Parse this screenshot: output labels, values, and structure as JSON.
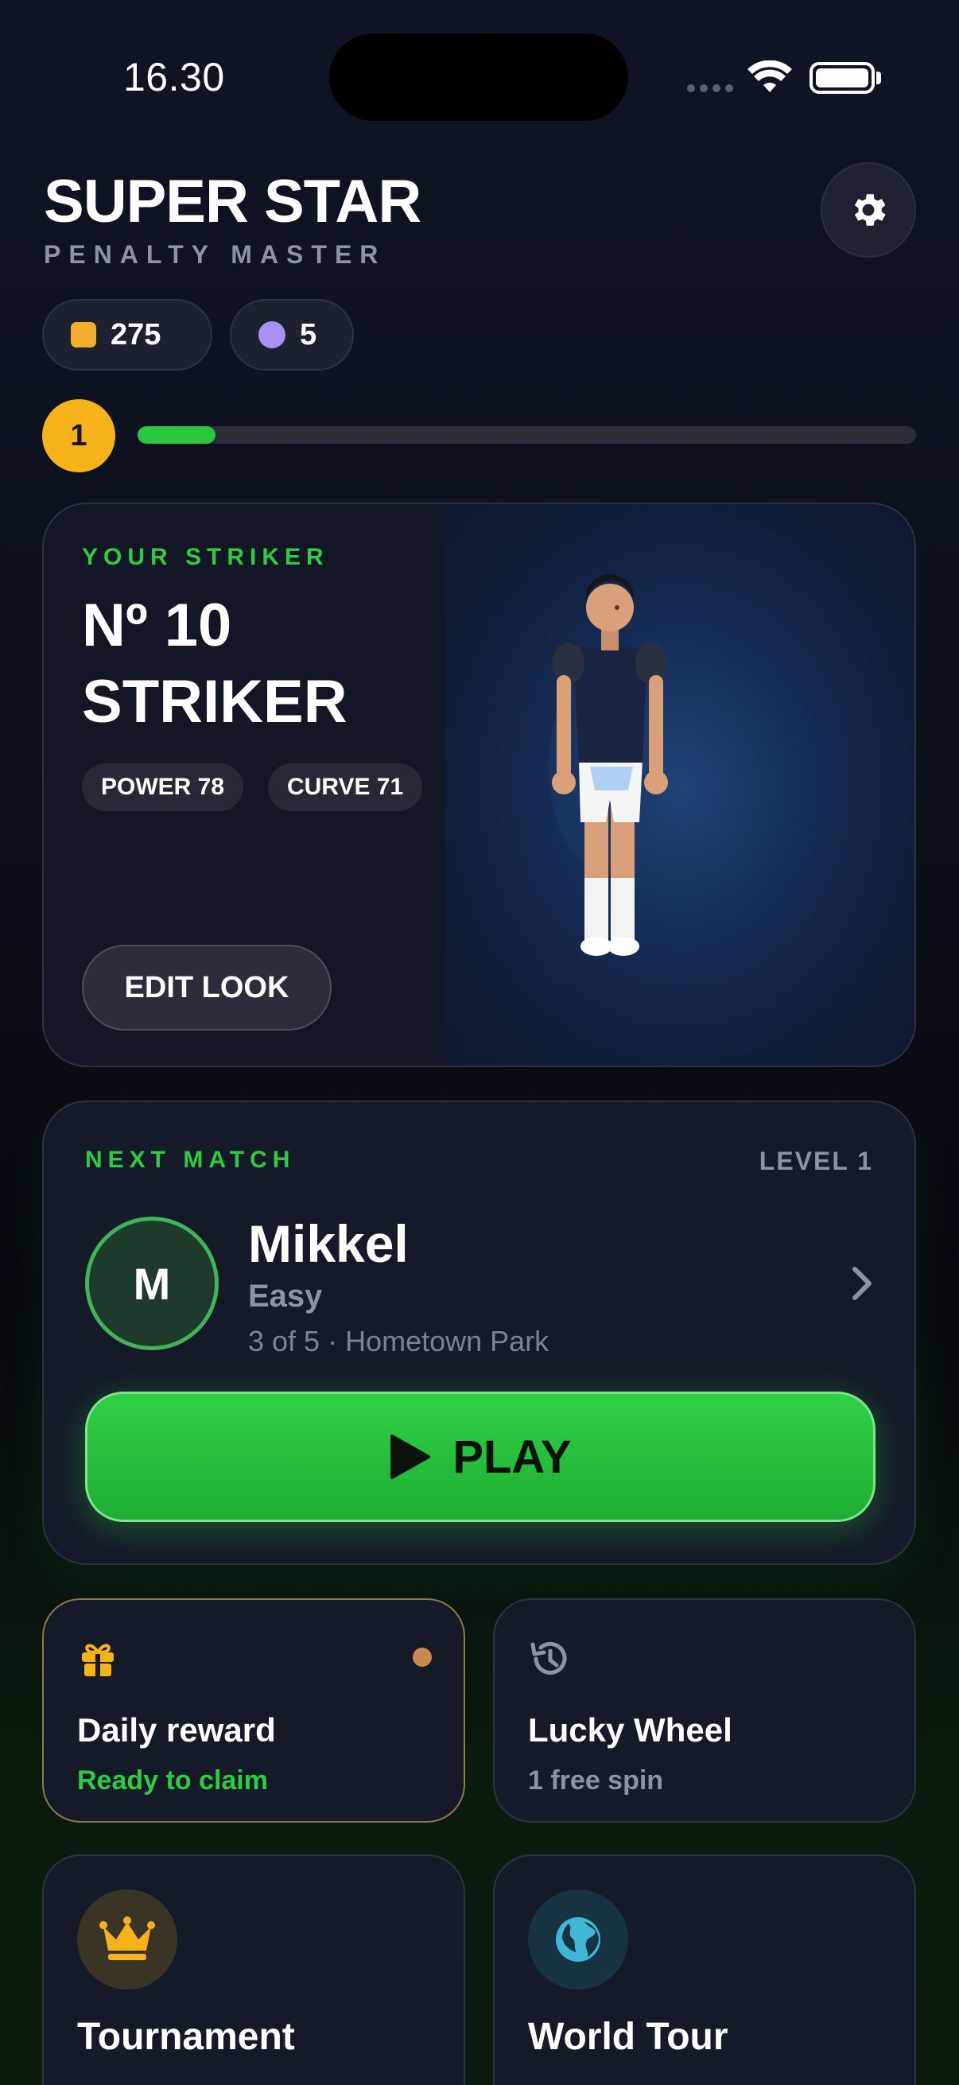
{
  "status_bar": {
    "time": "16.30"
  },
  "header": {
    "title": "SUPER STAR",
    "subtitle": "PENALTY MASTER"
  },
  "currency": {
    "coins": "275",
    "gems": "5"
  },
  "level": {
    "number": "1",
    "xp_progress": 0.1
  },
  "striker": {
    "label": "YOUR STRIKER",
    "name_line1": "Nº 10",
    "name_line2": "STRIKER",
    "power": "POWER 78",
    "curve": "CURVE 71",
    "edit_label": "EDIT LOOK"
  },
  "next_match": {
    "label": "NEXT MATCH",
    "level": "LEVEL 1",
    "avatar_initial": "M",
    "opponent": "Mikkel",
    "difficulty": "Easy",
    "progress": "3 of 5 · Hometown Park",
    "play_label": "PLAY"
  },
  "tiles": {
    "daily": {
      "title": "Daily reward",
      "subtitle": "Ready to claim",
      "icon": "gift-icon"
    },
    "lucky": {
      "title": "Lucky Wheel",
      "subtitle": "1 free spin",
      "icon": "history-icon"
    },
    "tournament": {
      "title": "Tournament",
      "icon": "crown-icon"
    },
    "world": {
      "title": "World Tour",
      "icon": "globe-icon"
    }
  },
  "colors": {
    "accent_green": "#2ecc40",
    "gold": "#f5b21a",
    "gem": "#a691f5"
  }
}
